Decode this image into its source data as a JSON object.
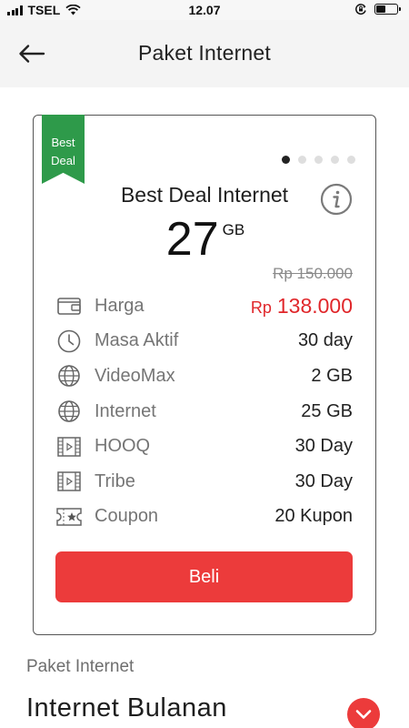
{
  "status_bar": {
    "carrier": "TSEL",
    "time": "12.07",
    "battery_level": 0.45,
    "icons": [
      "signal-icon",
      "wifi-icon",
      "orientation-lock-icon",
      "battery-icon"
    ]
  },
  "header": {
    "title": "Paket Internet",
    "back_icon": "arrow-left-icon"
  },
  "card": {
    "ribbon": {
      "line1": "Best",
      "line2": "Deal",
      "color": "#2e9a4a"
    },
    "carousel": {
      "count": 5,
      "active_index": 0
    },
    "plan_name": "Best Deal Internet",
    "info_icon": "info-icon",
    "quota": {
      "value": "27",
      "unit": "GB"
    },
    "old_price": "Rp 150.000",
    "rows": [
      {
        "icon": "wallet-icon",
        "label": "Harga",
        "currency": "Rp",
        "value": "138.000"
      },
      {
        "icon": "clock-icon",
        "label": "Masa Aktif",
        "value": "30 day"
      },
      {
        "icon": "globe-icon",
        "label": "VideoMax",
        "value": "2 GB"
      },
      {
        "icon": "globe-icon",
        "label": "Internet",
        "value": "25 GB"
      },
      {
        "icon": "film-icon",
        "label": "HOOQ",
        "value": "30 Day"
      },
      {
        "icon": "film-icon",
        "label": "Tribe",
        "value": "30 Day"
      },
      {
        "icon": "ticket-star-icon",
        "label": "Coupon",
        "value": "20 Kupon"
      }
    ],
    "buy_label": "Beli"
  },
  "section": {
    "label": "Paket Internet",
    "title": "Internet Bulanan",
    "expand_icon": "chevron-down-icon"
  },
  "colors": {
    "accent_red": "#ec3b3b",
    "price_red": "#e0262a",
    "ribbon_green": "#2e9a4a"
  }
}
